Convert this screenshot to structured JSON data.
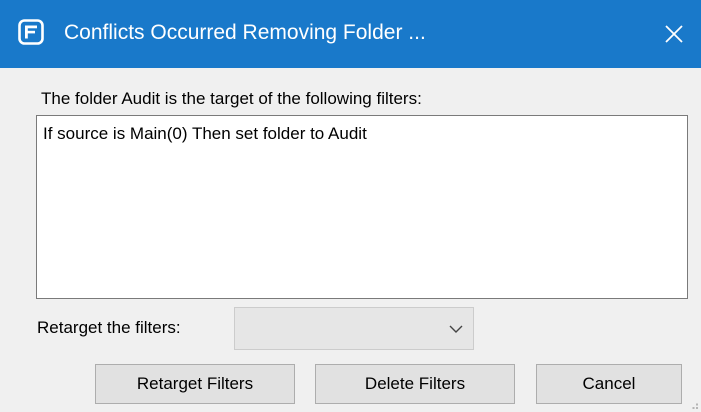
{
  "window": {
    "title": "Conflicts Occurred Removing Folder ...",
    "app_icon": "app-logo-icon",
    "close_icon": "close-icon",
    "titlebar_color": "#1979ca"
  },
  "main": {
    "prompt": "The folder Audit is the target of the following filters:",
    "filters": [
      "If source is Main(0) Then set folder to Audit"
    ],
    "retarget_label": "Retarget the filters:",
    "retarget_select": {
      "value": "",
      "icon": "chevron-down-icon"
    }
  },
  "buttons": {
    "retarget": "Retarget Filters",
    "delete": "Delete Filters",
    "cancel": "Cancel"
  }
}
